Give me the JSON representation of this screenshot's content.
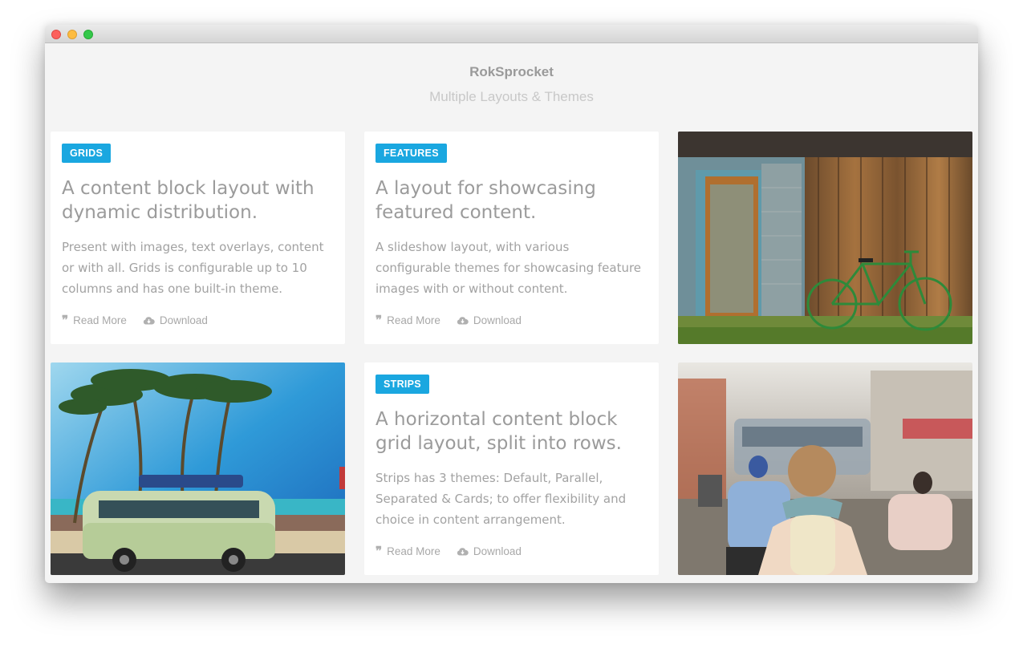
{
  "window": {
    "controls": [
      "close",
      "minimize",
      "zoom"
    ]
  },
  "header": {
    "title": "RokSprocket",
    "subtitle": "Multiple Layouts & Themes"
  },
  "cards": [
    {
      "tag": "GRIDS",
      "title": "A content block layout with dynamic distribution.",
      "description": "Present with images, text overlays, content or with all. Grids is configurable up to 10 columns and has one built-in theme.",
      "read_more": "Read More",
      "download": "Download"
    },
    {
      "tag": "FEATURES",
      "title": "A layout for showcasing featured content.",
      "description": "A slideshow layout, with various configurable themes for showcasing feature images with or without content.",
      "read_more": "Read More",
      "download": "Download"
    },
    {
      "tag": "STRIPS",
      "title": "A horizontal content block grid layout, split into rows.",
      "description": "Strips has 3 themes: Default, Parallel, Separated & Cards; to offer flexibility and choice in content arrangement.",
      "read_more": "Read More",
      "download": "Download"
    }
  ],
  "colors": {
    "tag_background": "#1aa7e0",
    "page_background": "#f4f4f4"
  },
  "icons": {
    "read_more": "quote-icon",
    "download": "cloud-download-icon"
  }
}
